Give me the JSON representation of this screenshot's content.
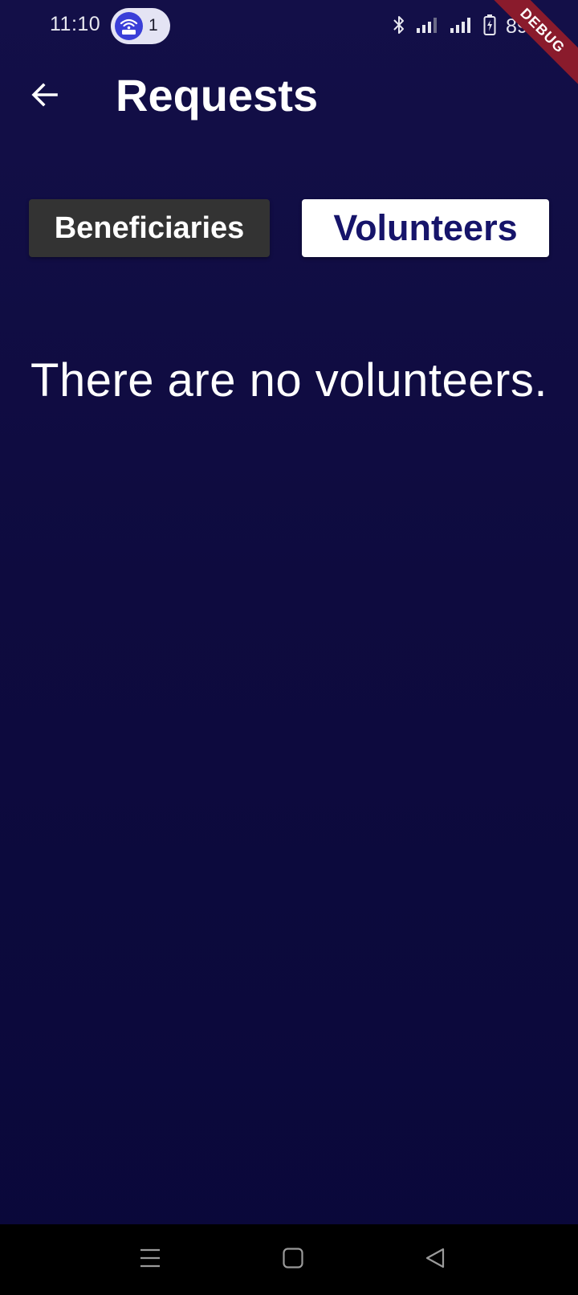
{
  "status_bar": {
    "time": "11:10",
    "hotspot_count": "1",
    "battery_text": "89%",
    "icons": [
      "hotspot-icon",
      "bluetooth-icon",
      "signal-icon",
      "battery-icon"
    ]
  },
  "debug_banner": {
    "label": "DEBUG",
    "color": "#8a1b2c"
  },
  "app_bar": {
    "title": "Requests",
    "back_icon": "arrow-left-icon"
  },
  "tabs": [
    {
      "label": "Beneficiaries",
      "selected": false,
      "background": "#333333",
      "text_color": "#ffffff"
    },
    {
      "label": "Volunteers",
      "selected": true,
      "background": "#ffffff",
      "text_color": "#16146a"
    }
  ],
  "main": {
    "empty_message": "There are no volunteers."
  },
  "nav_bar": {
    "buttons": [
      "menu-icon",
      "home-icon",
      "back-triangle-icon"
    ]
  },
  "colors": {
    "background": "#130f48",
    "accent": "#3a3fd8"
  }
}
